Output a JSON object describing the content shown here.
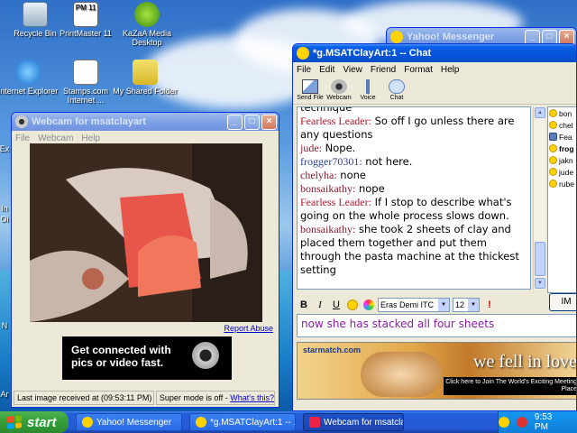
{
  "desktop": {
    "icons": [
      {
        "label": "Recycle Bin",
        "icon": "recycle-bin-icon"
      },
      {
        "label": "PrintMaster 11",
        "icon": "printmaster-icon",
        "badge": "PM 11"
      },
      {
        "label": "KaZaA Media Desktop",
        "icon": "kazaa-icon"
      },
      {
        "label": "Internet Explorer",
        "icon": "internet-explorer-icon"
      },
      {
        "label": "Stamps.com Internet ...",
        "icon": "stamps-icon"
      },
      {
        "label": "My Shared Folder",
        "icon": "shared-folder-icon"
      }
    ],
    "edge_labels": [
      "Ex",
      "In",
      "Oi",
      "N",
      "Ar"
    ]
  },
  "yahoo_messenger": {
    "title": "Yahoo! Messenger"
  },
  "chat": {
    "title": "*g.MSATClayArt:1 -- Chat",
    "menu": [
      "File",
      "Edit",
      "View",
      "Friend",
      "Format",
      "Help"
    ],
    "toolbar": [
      {
        "label": "Send File",
        "icon": "send-file-icon"
      },
      {
        "label": "Webcam",
        "icon": "webcam-icon"
      },
      {
        "label": "Voice",
        "icon": "microphone-icon"
      },
      {
        "label": "Chat",
        "icon": "chat-bubbles-icon"
      }
    ],
    "messages": [
      {
        "name": "",
        "text": "technique"
      },
      {
        "name": "Fearless Leader:",
        "text": " So off I go unless there are any questions"
      },
      {
        "name": "jude:",
        "text": " Nope."
      },
      {
        "name": "frogger70301:",
        "text": " not here."
      },
      {
        "name": "chelyha:",
        "text": " none"
      },
      {
        "name": "bonsaikathy:",
        "text": " nope"
      },
      {
        "name": "Fearless Leader:",
        "text": " If I stop to describe what's going on the whole process slows down."
      },
      {
        "name": "bonsaikathy:",
        "text": " she took 2 sheets of clay and placed them together and put them through the pasta machine at the thickest setting"
      }
    ],
    "users": [
      "bon",
      "chel",
      "Fea",
      "frog",
      "jakn",
      "jude",
      "rube"
    ],
    "format": {
      "bold": "B",
      "italic": "I",
      "underline": "U",
      "font": "Eras Demi ITC",
      "size": "12"
    },
    "input_value": "now she has stacked all four sheets",
    "im_button": "IM",
    "ad": {
      "site": "starmatch.com",
      "headline": "we fell in love",
      "sub": "Click here to Join The World's Exciting Meeting Place"
    }
  },
  "webcam": {
    "title": "Webcam for msatclayart",
    "menu": [
      "File",
      "Webcam",
      "Help"
    ],
    "report_link": "Report Abuse",
    "promo": "Get connected with pics or video fast.",
    "status_last": "Last image received at (09:53:11 PM)",
    "status_super": "Super mode is off - ",
    "status_link": "What's this?"
  },
  "taskbar": {
    "start": "start",
    "tasks": [
      "Yahoo! Messenger",
      "*g.MSATClayArt:1 -- ...",
      "Webcam for msatclay..."
    ],
    "clock": "9:53 PM"
  }
}
